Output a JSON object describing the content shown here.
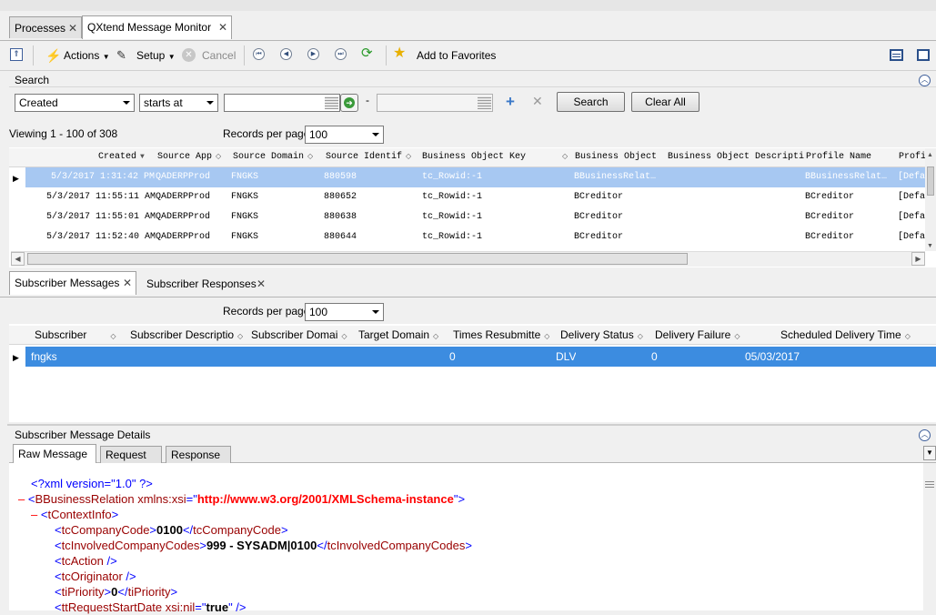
{
  "tabs": [
    {
      "label": "Processes"
    },
    {
      "label": "QXtend Message Monitor"
    }
  ],
  "toolbar": {
    "actions_label": "Actions",
    "setup_label": "Setup",
    "cancel_label": "Cancel",
    "favorites_label": "Add to Favorites"
  },
  "search": {
    "title": "Search",
    "field_selected": "Created",
    "operator_selected": "starts at",
    "dash": "-",
    "search_button": "Search",
    "clear_button": "Clear All"
  },
  "paging": {
    "viewing": "Viewing  1 - 100  of  308",
    "records_label": "Records per page:",
    "records_value": "100"
  },
  "messages": {
    "columns": [
      "Created",
      "Source App",
      "Source Domain",
      "Source Identif",
      "Business Object Key",
      "Business Object",
      "Business Object Descripti",
      "Profile Name",
      "Profi"
    ],
    "rows": [
      [
        "5/3/2017 1:31:42 PM",
        "QADERPProd",
        "FNGKS",
        "880598",
        "tc_Rowid:-1",
        "BBusinessRelat…",
        "",
        "BBusinessRelat…",
        "[Defa"
      ],
      [
        "5/3/2017 11:55:11 AM",
        "QADERPProd",
        "FNGKS",
        "880652",
        "tc_Rowid:-1",
        "BCreditor",
        "",
        "BCreditor",
        "[Defa"
      ],
      [
        "5/3/2017 11:55:01 AM",
        "QADERPProd",
        "FNGKS",
        "880638",
        "tc_Rowid:-1",
        "BCreditor",
        "",
        "BCreditor",
        "[Defa"
      ],
      [
        "5/3/2017 11:52:40 AM",
        "QADERPProd",
        "FNGKS",
        "880644",
        "tc_Rowid:-1",
        "BCreditor",
        "",
        "BCreditor",
        "[Defa"
      ]
    ]
  },
  "subtabs": [
    {
      "label": "Subscriber Messages"
    },
    {
      "label": "Subscriber Responses"
    }
  ],
  "subscriber": {
    "records_label": "Records per page:",
    "records_value": "100",
    "columns": [
      "Subscriber",
      "Subscriber Descriptio",
      "Subscriber Domai",
      "Target Domain",
      "Times Resubmitte",
      "Delivery Status",
      "Delivery Failure",
      "Scheduled Delivery Time"
    ],
    "rows": [
      [
        "fngks",
        "",
        "",
        "",
        "0",
        "DLV",
        "0",
        "05/03/2017"
      ]
    ]
  },
  "details": {
    "title": "Subscriber Message Details",
    "tabs": [
      {
        "label": "Raw Message"
      },
      {
        "label": "Request"
      },
      {
        "label": "Response"
      }
    ],
    "xml": {
      "pi": "<?xml version=\"1.0\" ?>",
      "minus": "–",
      "root_open": "<",
      "root_tag": "BBusinessRelation",
      "root_attr": " xmlns:xsi",
      "root_eq": "=\"",
      "root_attr_val": "http://www.w3.org/2001/XMLSchema-instance",
      "root_close": "\">",
      "ctx_open": "<",
      "ctx_tag": "tContextInfo",
      "ctx_close": ">",
      "lines": [
        {
          "tag": "tcCompanyCode",
          "value": "0100"
        },
        {
          "tag": "tcInvolvedCompanyCodes",
          "value": "999 - SYSADM|0100"
        },
        {
          "tag": "tcAction",
          "value": ""
        },
        {
          "tag": "tcOriginator",
          "value": ""
        },
        {
          "tag": "tiPriority",
          "value": "0"
        },
        {
          "tag": "ttRequestStartDate",
          "attr": "xsi:nil",
          "attr_value": "true"
        }
      ]
    }
  }
}
